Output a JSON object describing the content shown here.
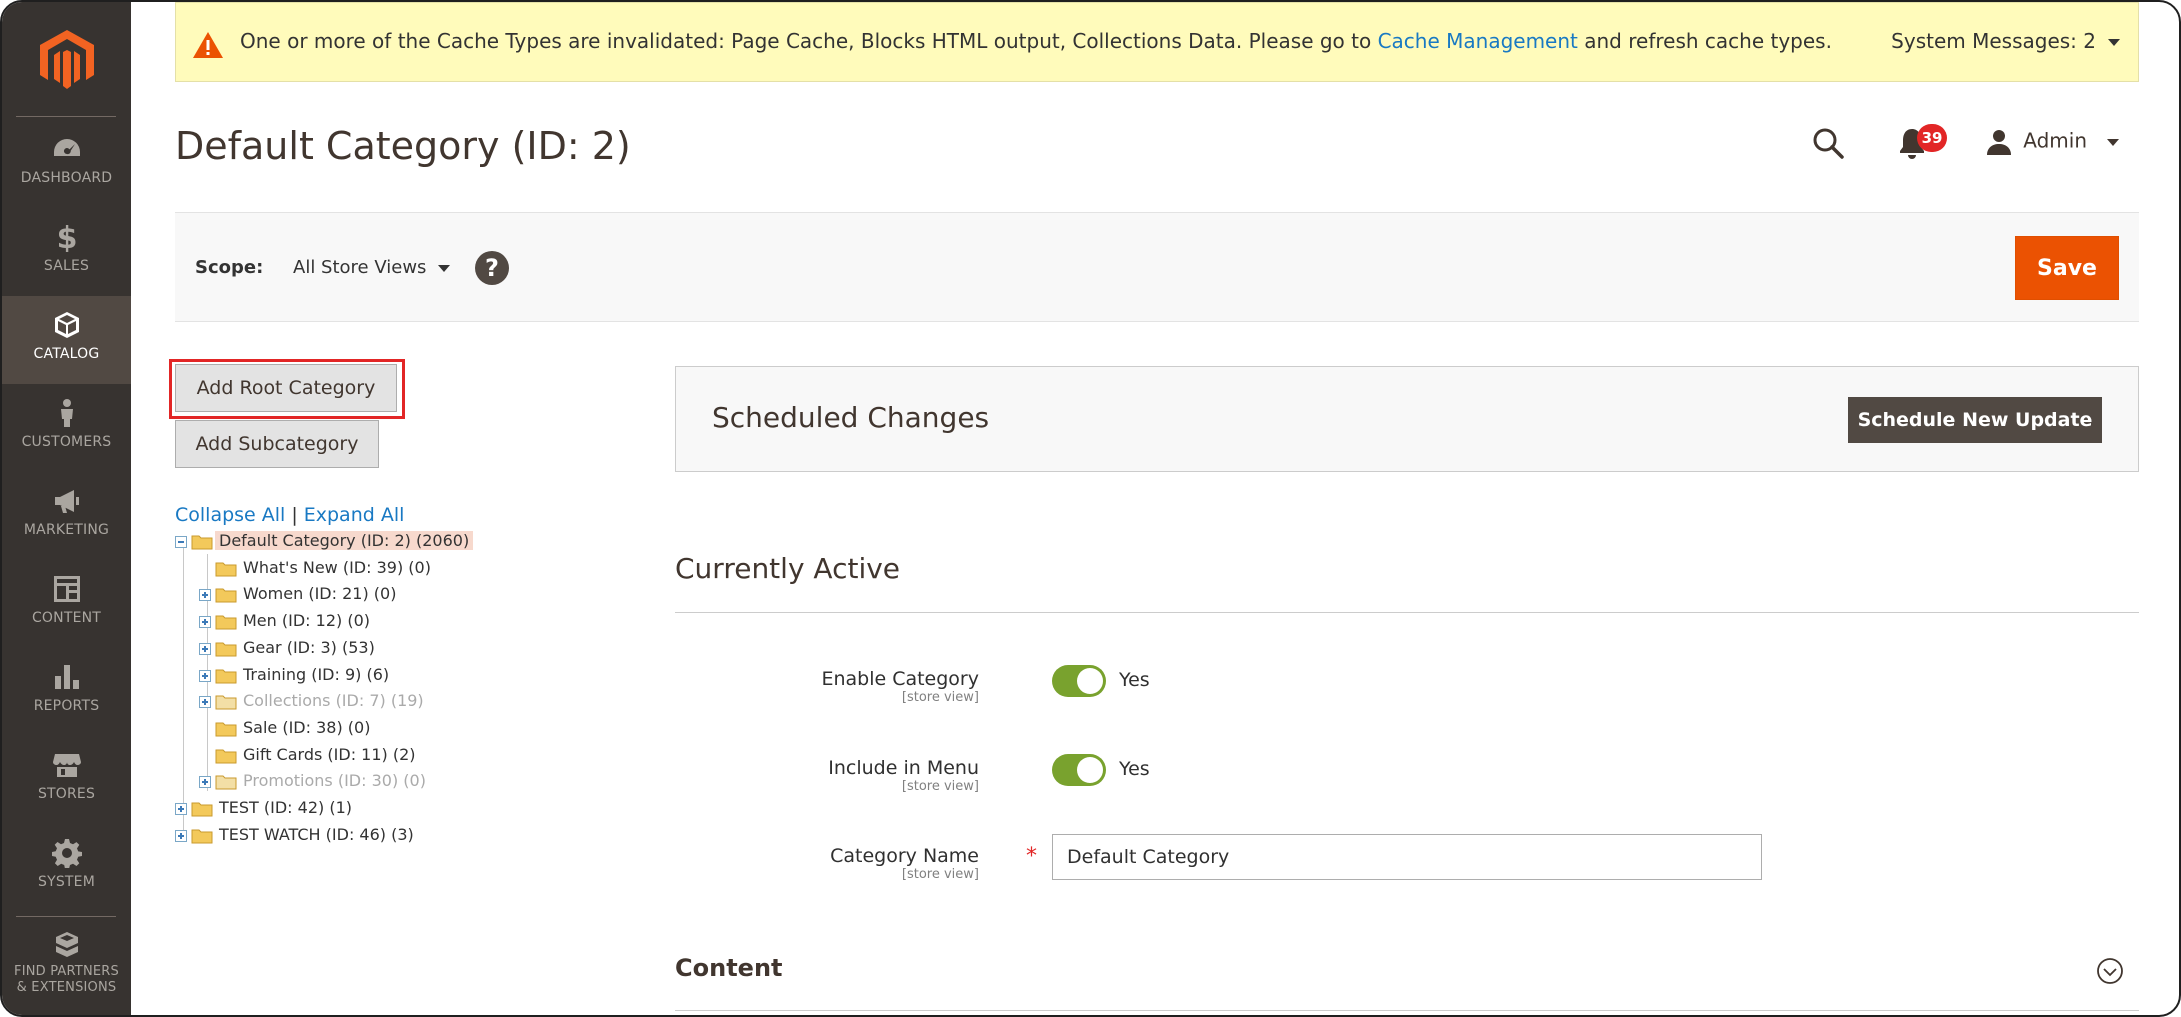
{
  "sidebar": {
    "items": [
      {
        "label": "DASHBOARD",
        "icon": "dashboard-icon"
      },
      {
        "label": "SALES",
        "icon": "dollar-icon"
      },
      {
        "label": "CATALOG",
        "icon": "box-icon",
        "active": true
      },
      {
        "label": "CUSTOMERS",
        "icon": "person-icon"
      },
      {
        "label": "MARKETING",
        "icon": "megaphone-icon"
      },
      {
        "label": "CONTENT",
        "icon": "layout-icon"
      },
      {
        "label": "REPORTS",
        "icon": "bar-chart-icon"
      },
      {
        "label": "STORES",
        "icon": "storefront-icon"
      },
      {
        "label": "SYSTEM",
        "icon": "gear-icon"
      }
    ],
    "extensions": {
      "line1": "FIND PARTNERS",
      "line2": "& EXTENSIONS",
      "icon": "blocks-icon"
    }
  },
  "alert": {
    "text_before": "One or more of the Cache Types are invalidated: Page Cache, Blocks HTML output, Collections Data. Please go to ",
    "link": "Cache Management",
    "text_after": " and refresh cache types.",
    "system_messages": "System Messages: 2"
  },
  "header": {
    "title": "Default Category (ID: 2)",
    "notifications_count": "39",
    "user": "Admin"
  },
  "scope": {
    "label": "Scope:",
    "value": "All Store Views",
    "help": "?",
    "save_label": "Save"
  },
  "tree_actions": {
    "add_root": "Add Root Category",
    "add_sub": "Add Subcategory",
    "collapse_all": "Collapse All",
    "separator": "|",
    "expand_all": "Expand All"
  },
  "tree": [
    {
      "label": "Default Category (ID: 2) (2060)",
      "level": 0,
      "expander": "minus",
      "selected": true
    },
    {
      "label": "What's New (ID: 39) (0)",
      "level": 1,
      "expander": "none"
    },
    {
      "label": "Women (ID: 21) (0)",
      "level": 1,
      "expander": "plus"
    },
    {
      "label": "Men (ID: 12) (0)",
      "level": 1,
      "expander": "plus"
    },
    {
      "label": "Gear (ID: 3) (53)",
      "level": 1,
      "expander": "plus"
    },
    {
      "label": "Training (ID: 9) (6)",
      "level": 1,
      "expander": "plus"
    },
    {
      "label": "Collections (ID: 7) (19)",
      "level": 1,
      "expander": "plus",
      "disabled": true
    },
    {
      "label": "Sale (ID: 38) (0)",
      "level": 1,
      "expander": "none"
    },
    {
      "label": "Gift Cards (ID: 11) (2)",
      "level": 1,
      "expander": "none"
    },
    {
      "label": "Promotions (ID: 30) (0)",
      "level": 1,
      "expander": "plus",
      "disabled": true
    },
    {
      "label": "TEST (ID: 42) (1)",
      "level": 0,
      "expander": "plus"
    },
    {
      "label": "TEST WATCH (ID: 46) (3)",
      "level": 0,
      "expander": "plus"
    }
  ],
  "scheduled": {
    "title": "Scheduled Changes",
    "button": "Schedule New Update"
  },
  "active_section": {
    "title": "Currently Active",
    "enable_label": "Enable Category",
    "enable_scope": "[store view]",
    "enable_value": "Yes",
    "menu_label": "Include in Menu",
    "menu_scope": "[store view]",
    "menu_value": "Yes",
    "name_label": "Category Name",
    "name_scope": "[store view]",
    "name_required": "*",
    "name_value": "Default Category"
  },
  "content_section": {
    "title": "Content"
  },
  "colors": {
    "accent": "#eb5202",
    "sidebar": "#373330",
    "toggle_on": "#79a22e",
    "link": "#1979c3"
  }
}
